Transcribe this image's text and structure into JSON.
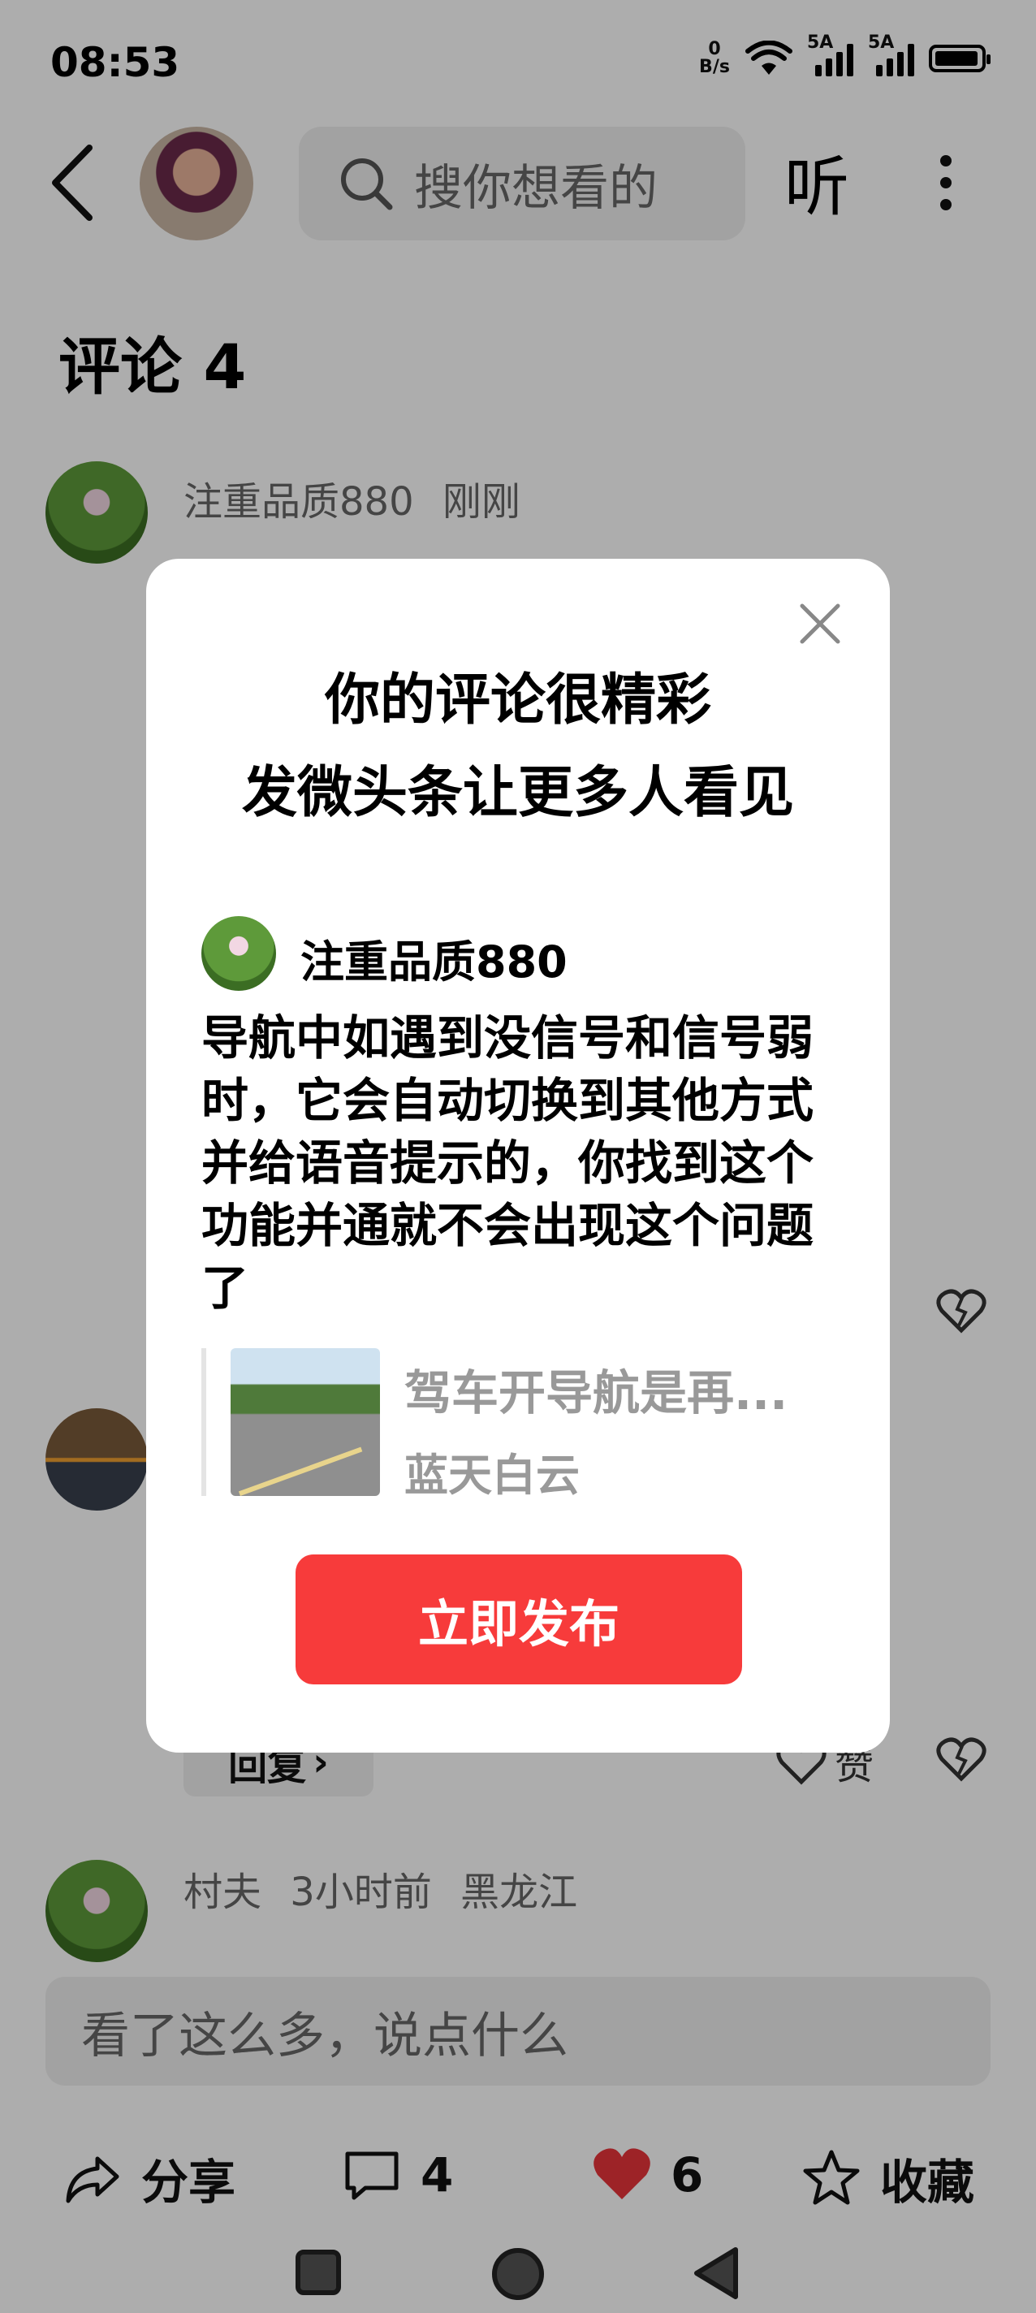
{
  "status": {
    "time": "08:53",
    "net_speed_value": "0",
    "net_speed_unit": "B/s",
    "sim1_label": "5A",
    "sim2_label": "5A"
  },
  "header": {
    "search_placeholder": "搜你想看的",
    "listen_label": "听"
  },
  "comments_title": "评论 4",
  "comments": [
    {
      "author": "注重品质880",
      "time": "刚刚",
      "text_visible": "导航中如遇到没信号和"
    },
    {
      "reply_label": "回复",
      "like_label": "赞"
    },
    {
      "author": "村夫",
      "time": "3小时前",
      "location": "黑龙江"
    }
  ],
  "comment_input_placeholder": "看了这么多，说点什么",
  "bottom_bar": {
    "share_label": "分享",
    "comment_count": "4",
    "like_count": "6",
    "favorite_label": "收藏",
    "like_color": "#e8343a"
  },
  "modal": {
    "title_line1": "你的评论很精彩",
    "title_line2": "发微头条让更多人看见",
    "username": "注重品质880",
    "comment_text": "导航中如遇到没信号和信号弱时，它会自动切换到其他方式并给语音提示的，你找到这个功能并通就不会出现这个问题了",
    "quote_title": "驾车开导航是再...",
    "quote_author": "蓝天白云",
    "publish_label": "立即发布",
    "publish_color": "#f73b3b"
  }
}
